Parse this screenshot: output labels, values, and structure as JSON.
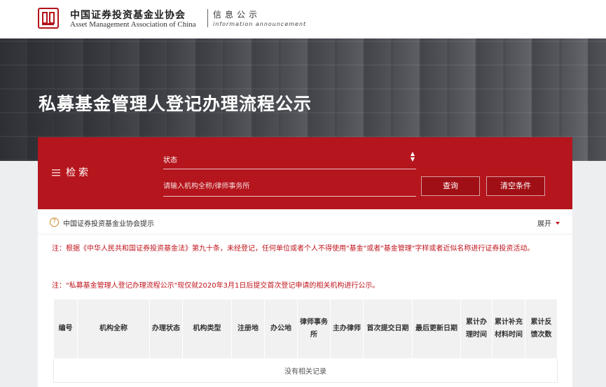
{
  "header": {
    "org_name_cn": "中国证券投资基金业协会",
    "org_name_en": "Asset Management Association of China",
    "section_cn": "信息公示",
    "section_en": "information announcement"
  },
  "hero": {
    "title": "私募基金管理人登记办理流程公示"
  },
  "search": {
    "label": "检索",
    "status_value": "状态",
    "name_placeholder": "请输入机构全称/律师事务所",
    "query_label": "查询",
    "clear_label": "清空条件"
  },
  "notice": {
    "title": "中国证券投资基金业协会提示",
    "expand_label": "展开",
    "note1": "注：根据《中华人民共和国证券投资基金法》第九十条，未经登记，任何单位或者个人不得使用\"基金\"或者\"基金管理\"字样或者近似名称进行证券投资活动。",
    "note2": "注：\"私募基金管理人登记办理流程公示\"现仅就2020年3月1日后提交首次登记申请的相关机构进行公示。"
  },
  "table": {
    "columns": [
      "编号",
      "机构全称",
      "办理状态",
      "机构类型",
      "注册地",
      "办公地",
      "律师事务所",
      "主办律师",
      "首次提交日期",
      "最后更新日期",
      "累计办理时间",
      "累计补充材料时间",
      "累计反馈次数"
    ],
    "empty_text": "没有相关记录"
  },
  "colors": {
    "brand_red": "#b5151c",
    "notice_red": "#c0141c"
  }
}
